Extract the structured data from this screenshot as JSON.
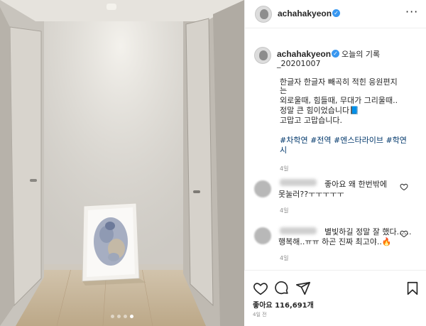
{
  "post": {
    "username": "achahakyeon",
    "verified_mark": "✓",
    "more_icon": "more-horizontal-icon"
  },
  "caption": {
    "first": "오늘의 기록",
    "second": "_20201007",
    "body": [
      "한글자 한글자 빼곡히 적힌 응원편지",
      "는",
      "외로울때, 힘들때, 무대가 그리울때..",
      "정말 큰 힘이었습니다📘",
      "고맙고 고맙습니다."
    ],
    "tags": [
      "#차학연 #전역 #엔스타라이브 #학연",
      "시"
    ],
    "time": "4일"
  },
  "comments": [
    {
      "lines": [
        "좋아요 왜 한번밖에",
        "못눌러??ㅜㅜㅜㅜㅜ"
      ],
      "time": "4일"
    },
    {
      "lines": [
        "별빛하길 정말 잘 했다......",
        "행복해..ㅠㅠ 하곤 진짜 최고야..🔥"
      ],
      "time": "4일"
    }
  ],
  "actions": {
    "icons": [
      "heart-icon",
      "comment-icon",
      "share-icon",
      "bookmark-icon"
    ],
    "likes_label": "좋아요 116,691개",
    "posted_time": "4일 전"
  },
  "carousel": {
    "slides": 4,
    "active_index": 3
  }
}
